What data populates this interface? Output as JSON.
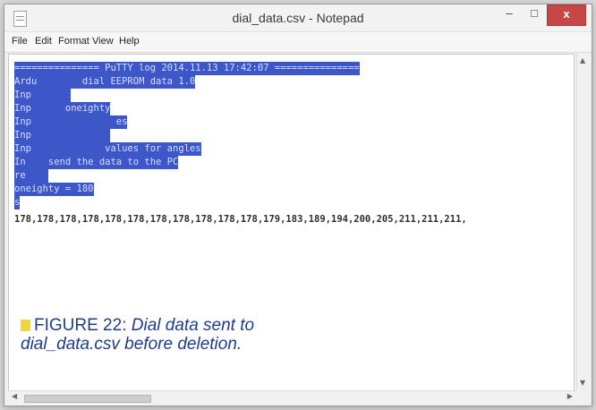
{
  "window": {
    "title": "dial_data.csv - Notepad",
    "buttons": {
      "minimize": "–",
      "maximize": "□",
      "close": "x"
    }
  },
  "menu": [
    "File",
    "Edit",
    "Format",
    "View",
    "Help"
  ],
  "editor": {
    "selected_lines": [
      "=============== PuTTY log 2014.11.13 17:42:07 ===============",
      "Ardu        dial EEPROM data 1.0",
      "Inp       ",
      "Inp      oneighty",
      "Inp               es",
      "Inp              ",
      "Inp             values for angles",
      "In    send the data to the PC",
      "re    ",
      "oneighty = 180",
      "s"
    ],
    "data_line": "178,178,178,178,178,178,178,178,178,178,178,179,183,189,194,200,205,211,211,211,"
  },
  "caption": {
    "label": "FIGURE 22:",
    "text_line1": "Dial data sent to",
    "text_line2": "dial_data.csv before deletion."
  },
  "colors": {
    "selection": "#3d57c9",
    "close_button": "#c74646",
    "caption_text": "#1f3c87",
    "caption_marker": "#f3d43a"
  }
}
